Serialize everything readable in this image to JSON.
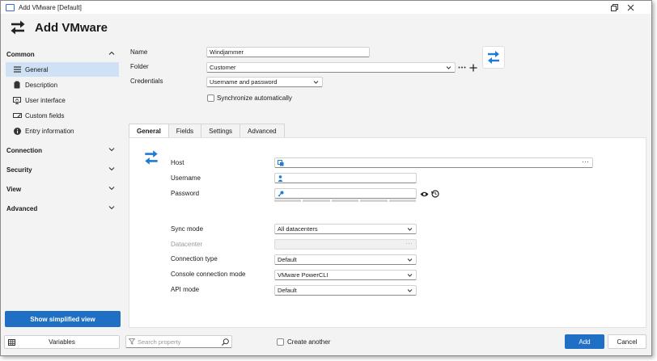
{
  "window": {
    "title": "Add VMware [Default]",
    "heading": "Add VMware"
  },
  "sidebar": {
    "sections": [
      {
        "label": "Common",
        "expanded": true
      },
      {
        "label": "Connection",
        "expanded": false
      },
      {
        "label": "Security",
        "expanded": false
      },
      {
        "label": "View",
        "expanded": false
      },
      {
        "label": "Advanced",
        "expanded": false
      }
    ],
    "common_items": [
      {
        "label": "General",
        "icon": "list-icon",
        "selected": true
      },
      {
        "label": "Description",
        "icon": "clipboard-icon"
      },
      {
        "label": "User interface",
        "icon": "monitor-icon"
      },
      {
        "label": "Custom fields",
        "icon": "edit-field-icon"
      },
      {
        "label": "Entry information",
        "icon": "info-icon"
      }
    ],
    "simplified_button": "Show simplified view"
  },
  "form": {
    "name_label": "Name",
    "name_value": "Windjammer",
    "folder_label": "Folder",
    "folder_value": "Customer",
    "credentials_label": "Credentials",
    "credentials_value": "Username and password",
    "sync_label": "Synchronize automatically"
  },
  "tabs": [
    "General",
    "Fields",
    "Settings",
    "Advanced"
  ],
  "general": {
    "host_label": "Host",
    "host_value": "",
    "username_label": "Username",
    "username_value": "",
    "password_label": "Password",
    "password_value": "",
    "sync_mode_label": "Sync mode",
    "sync_mode_value": "All datacenters",
    "datacenter_label": "Datacenter",
    "datacenter_value": "",
    "connection_type_label": "Connection type",
    "connection_type_value": "Default",
    "console_mode_label": "Console connection mode",
    "console_mode_value": "VMware PowerCLI",
    "api_mode_label": "API mode",
    "api_mode_value": "Default"
  },
  "bottom": {
    "variables_label": "Variables",
    "search_placeholder": "Search property",
    "create_another_label": "Create another",
    "add_label": "Add",
    "cancel_label": "Cancel"
  },
  "colors": {
    "accent": "#1f6fc5",
    "selected": "#cfe2f5",
    "arrow_blue": "#1e7bd6"
  }
}
